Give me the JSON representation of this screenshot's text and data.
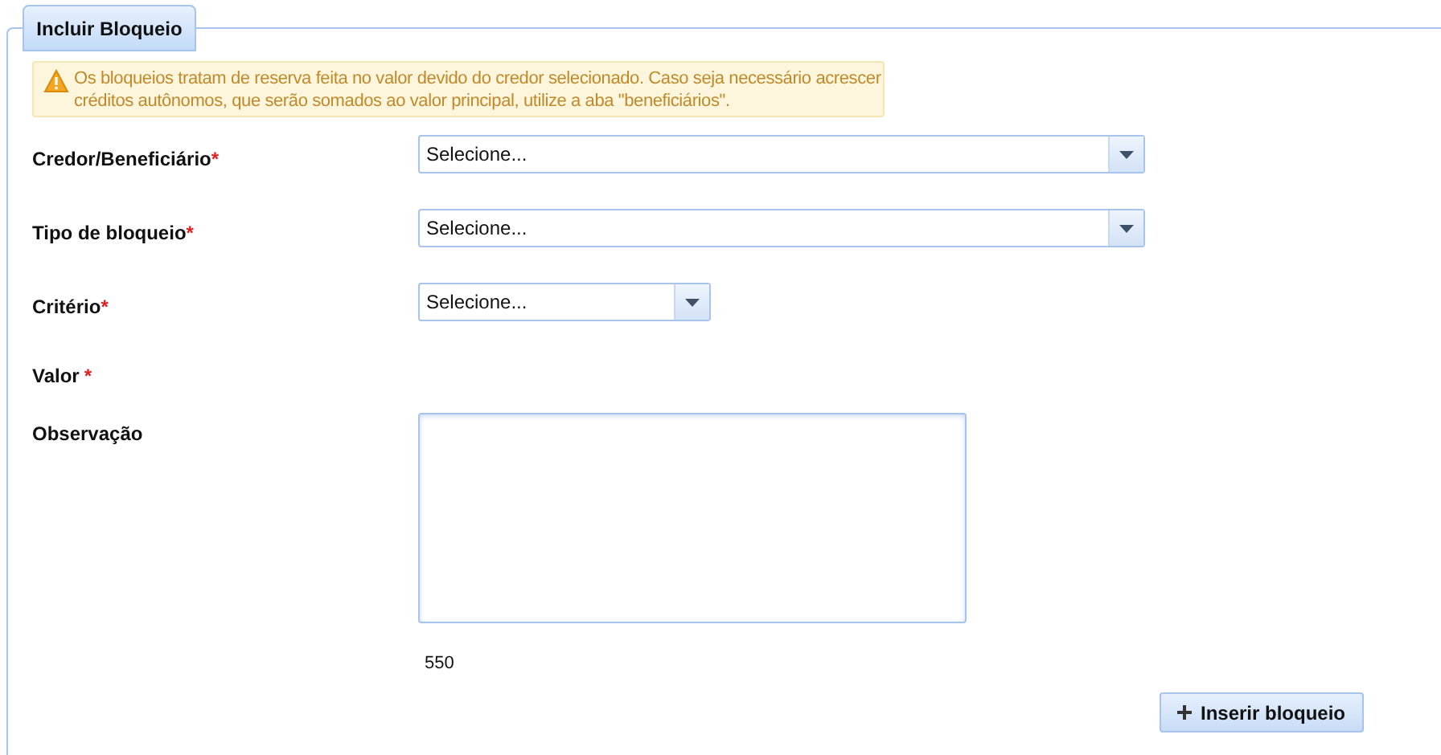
{
  "panel": {
    "tab": "Incluir Bloqueio"
  },
  "alert": {
    "text": "Os bloqueios tratam de reserva feita no valor devido do credor selecionado. Caso seja necessário acrescer créditos autônomos, que serão somados ao valor principal, utilize a aba \"beneficiários\"."
  },
  "fields": [
    {
      "label": "Credor/Beneficiário",
      "marker": "*",
      "kind": "select",
      "placeholder": "Selecione..."
    },
    {
      "label": "Tipo de bloqueio",
      "marker": "*",
      "kind": "select",
      "placeholder": "Selecione..."
    },
    {
      "label": "Critério",
      "marker": "*",
      "kind": "select_short",
      "placeholder": "Selecione..."
    },
    {
      "label": "Valor",
      "marker": "*",
      "kind": "none"
    },
    {
      "label": "Observação",
      "kind": "textarea",
      "counter": "550"
    }
  ],
  "button": {
    "label": "Inserir bloqueio"
  }
}
